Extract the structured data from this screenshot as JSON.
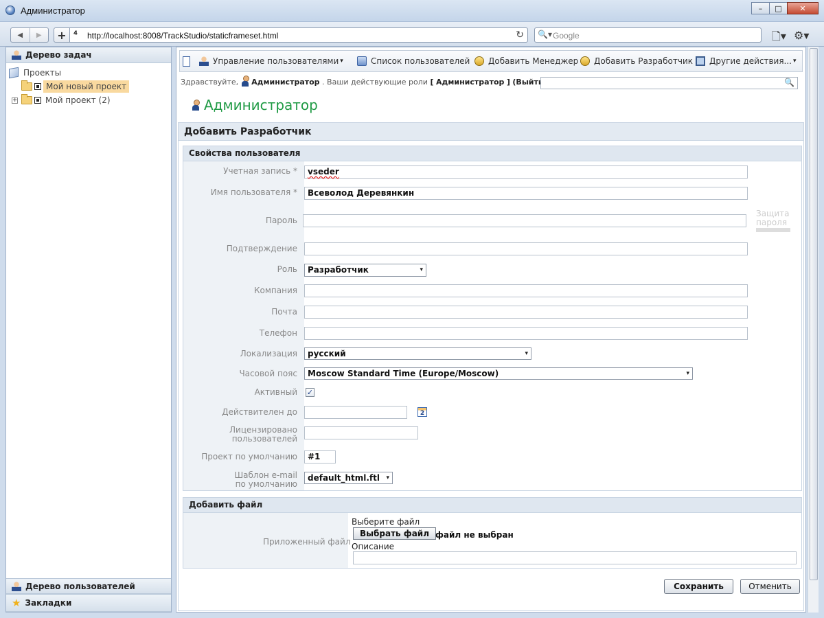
{
  "window": {
    "title": "Администратор",
    "minimize": "–",
    "maximize": "□",
    "close": "✕"
  },
  "browser": {
    "back": "◀",
    "forward": "▶",
    "new_tab": "+",
    "url": "http://localhost:8008/TrackStudio/staticframeset.html",
    "reload": "↻",
    "search_placeholder": "Google",
    "page_menu": "🗋▾",
    "tools_menu": "⚙▾"
  },
  "left_panel": {
    "header": "Дерево задач",
    "tree": [
      {
        "label": "Проекты",
        "type": "root"
      },
      {
        "label": "Мой новый проект",
        "type": "project",
        "selected": true
      },
      {
        "label": "Мой проект (2)",
        "type": "project",
        "expander": "+"
      }
    ],
    "bottom": [
      {
        "label": "Дерево пользователей",
        "icon": "users-icon"
      },
      {
        "label": "Закладки",
        "icon": "star-icon"
      }
    ]
  },
  "toolbar": {
    "items": [
      {
        "label": "Управление пользователями",
        "has_menu": true
      },
      {
        "label": "Список пользователей",
        "has_menu": false
      },
      {
        "label": "Добавить Менеджер",
        "has_menu": false
      },
      {
        "label": "Добавить Разработчик",
        "has_menu": false
      },
      {
        "label": "Другие действия...",
        "has_menu": true
      }
    ]
  },
  "greeting": {
    "hello": "Здравствуйте,",
    "user": "Администратор",
    "roles_text": ". Ваши действующие роли",
    "role_open": "[",
    "role": "Администратор",
    "role_close": "]",
    "logout": "(Выйти)"
  },
  "page": {
    "title": "Администратор",
    "form_title": "Добавить Разработчик"
  },
  "user_props": {
    "section_title": "Свойства пользователя",
    "login_label": "Учетная запись *",
    "login_value": "vseder",
    "name_label": "Имя пользователя *",
    "name_value": "Всеволод Деревянкин",
    "password_label": "Пароль",
    "password_value": "",
    "password_hint": "Защита пароля",
    "confirm_label": "Подтверждение",
    "confirm_value": "",
    "role_label": "Роль",
    "role_value": "Разработчик",
    "company_label": "Компания",
    "company_value": "",
    "email_label": "Почта",
    "email_value": "",
    "phone_label": "Телефон",
    "phone_value": "",
    "locale_label": "Локализация",
    "locale_value": "русский",
    "timezone_label": "Часовой пояс",
    "timezone_value": "Moscow Standard Time (Europe/Moscow)",
    "active_label": "Активный",
    "active_checked": true,
    "valid_label": "Действителен до",
    "valid_value": "",
    "licensed_label": "Лицензировано пользователей",
    "licensed_value": "",
    "default_project_label": "Проект по умолчанию",
    "default_project_value": "#1",
    "email_template_label": "Шаблон e-mail по умолчанию",
    "email_template_value": "default_html.ftl"
  },
  "file_section": {
    "section_title": "Добавить файл",
    "attached_label": "Приложенный файл",
    "choose_label": "Выберите файл",
    "choose_button": "Выбрать файл",
    "no_file": "файл не выбран",
    "description_label": "Описание",
    "description_value": ""
  },
  "actions": {
    "save": "Сохранить",
    "cancel": "Отменить"
  },
  "glyphs": {
    "dropdown": "▾",
    "check": "✓",
    "calendar": "2",
    "search": "🔍"
  },
  "colors": {
    "title_green": "#1f9a44",
    "selection": "#f9d99f",
    "panel_header": "#dfe7f0"
  }
}
